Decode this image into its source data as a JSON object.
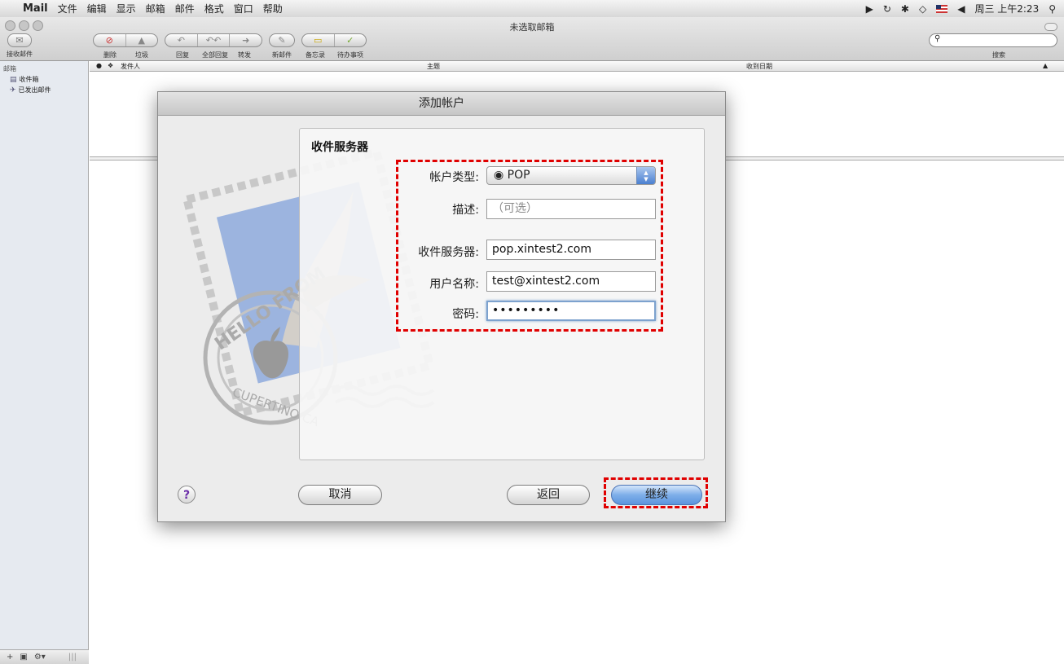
{
  "menubar": {
    "app_name": "Mail",
    "items": [
      "文件",
      "编辑",
      "显示",
      "邮箱",
      "邮件",
      "格式",
      "窗口",
      "帮助"
    ],
    "clock": "周三 上午2:23"
  },
  "window": {
    "title": "未选取邮箱"
  },
  "toolbar": {
    "get_mail": "接收邮件",
    "delete": "删除",
    "junk": "垃圾",
    "reply": "回复",
    "reply_all": "全部回复",
    "forward": "转发",
    "new_message": "新邮件",
    "note": "备忘录",
    "todo": "待办事项",
    "search_label": "搜索"
  },
  "sidebar": {
    "header": "邮箱",
    "items": [
      {
        "label": "收件箱",
        "icon": "inbox-icon"
      },
      {
        "label": "已发出邮件",
        "icon": "sent-icon"
      }
    ]
  },
  "message_list": {
    "columns": {
      "from": "发件人",
      "subject": "主题",
      "date": "收到日期"
    }
  },
  "dialog": {
    "title": "添加帐户",
    "section_title": "收件服务器",
    "account_type": {
      "label": "帐户类型:",
      "value": "POP"
    },
    "description": {
      "label": "描述:",
      "placeholder": "（可选）"
    },
    "incoming_server": {
      "label": "收件服务器:",
      "value": "pop.xintest2.com"
    },
    "username": {
      "label": "用户名称:",
      "value": "test@xintest2.com"
    },
    "password": {
      "label": "密码:",
      "value": "•••••••••"
    },
    "buttons": {
      "cancel": "取消",
      "back": "返回",
      "continue": "继续"
    },
    "help": "?",
    "stamp_text": {
      "top": "HELLO FROM",
      "bottom": "CUPERTINO CA"
    }
  },
  "colors": {
    "highlight": "#e00000",
    "default_button": "#5b95de",
    "focus_ring": "#7da2ce"
  }
}
